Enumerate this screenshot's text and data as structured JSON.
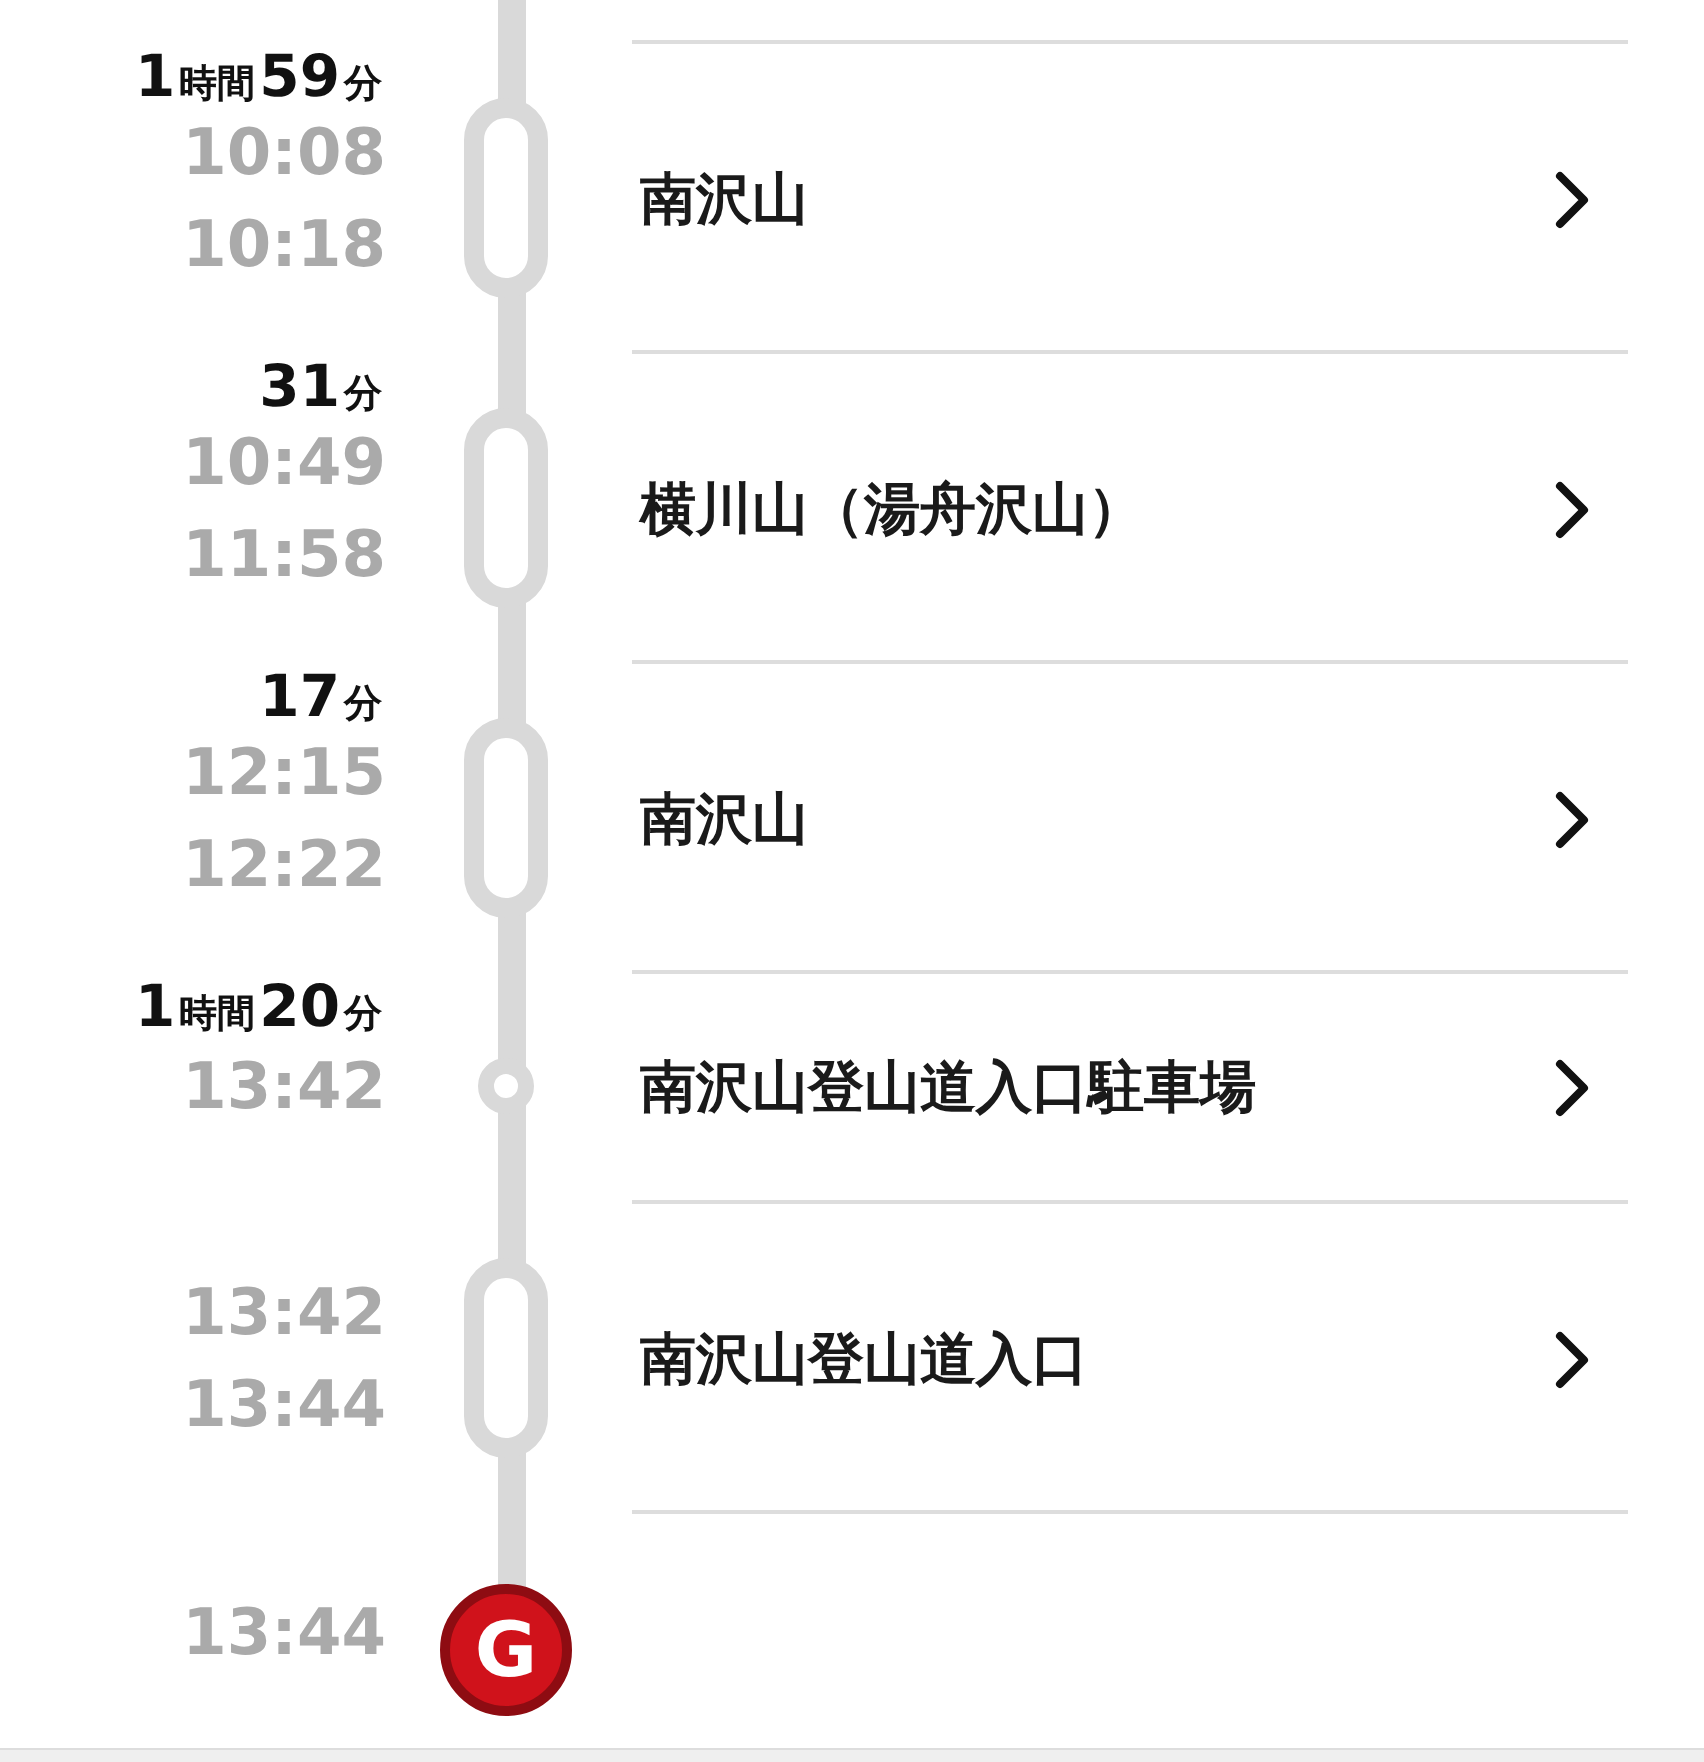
{
  "stops": [
    {
      "duration": [
        {
          "value": "1",
          "unit": "時間"
        },
        {
          "value": "59",
          "unit": "分"
        }
      ],
      "times": [
        "10:08",
        "10:18"
      ],
      "kind": "stay",
      "name": "南沢山"
    },
    {
      "duration": [
        {
          "value": "31",
          "unit": "分"
        }
      ],
      "times": [
        "10:49",
        "11:58"
      ],
      "kind": "stay",
      "name": "横川山（湯舟沢山）"
    },
    {
      "duration": [
        {
          "value": "17",
          "unit": "分"
        }
      ],
      "times": [
        "12:15",
        "12:22"
      ],
      "kind": "stay",
      "name": "南沢山"
    },
    {
      "duration": [
        {
          "value": "1",
          "unit": "時間"
        },
        {
          "value": "20",
          "unit": "分"
        }
      ],
      "times": [
        "13:42"
      ],
      "kind": "pass",
      "name": "南沢山登山道入口駐車場"
    },
    {
      "times": [
        "13:42",
        "13:44"
      ],
      "kind": "stay",
      "name": "南沢山登山道入口"
    }
  ],
  "goal": {
    "time": "13:44",
    "marker": "G"
  }
}
